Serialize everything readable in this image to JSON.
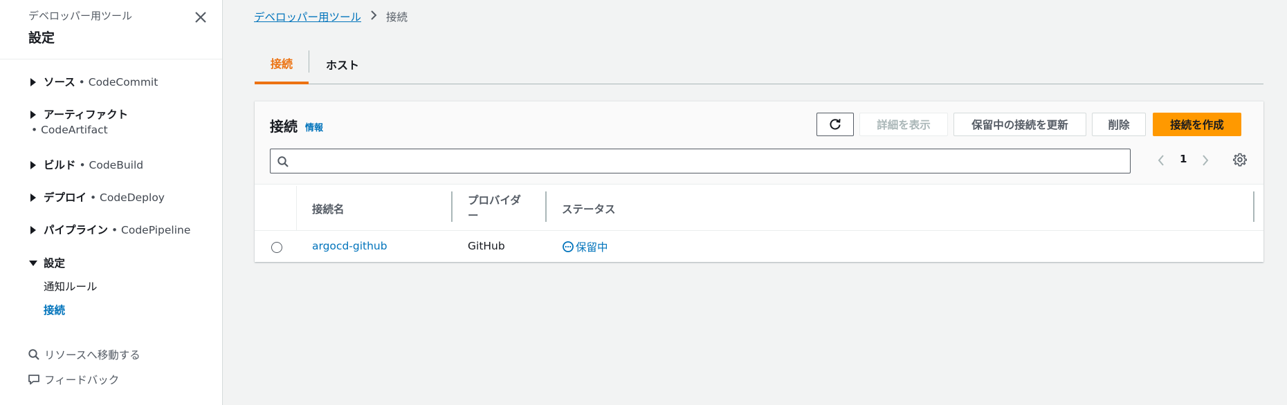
{
  "sidebar": {
    "subtitle": "デベロッパー用ツール",
    "title": "設定",
    "sections": [
      {
        "label": "ソース",
        "service": "• CodeCommit"
      },
      {
        "label": "アーティファクト",
        "service": "• CodeArtifact"
      },
      {
        "label": "ビルド",
        "service": "• CodeBuild"
      },
      {
        "label": "デプロイ",
        "service": "• CodeDeploy"
      },
      {
        "label": "パイプライン",
        "service": "• CodePipeline"
      },
      {
        "label": "設定",
        "service": ""
      }
    ],
    "settings_items": [
      "通知ルール",
      "接続"
    ],
    "utilities": {
      "goto_resource": "リソースへ移動する",
      "feedback": "フィードバック"
    }
  },
  "breadcrumb": {
    "root": "デベロッパー用ツール",
    "current": "接続"
  },
  "tabs": [
    {
      "label": "接続"
    },
    {
      "label": "ホスト"
    }
  ],
  "panel": {
    "title": "接続",
    "info": "情報",
    "buttons": {
      "view_details": "詳細を表示",
      "update_pending": "保留中の接続を更新",
      "delete": "削除",
      "create": "接続を作成"
    },
    "search": {
      "value": "",
      "placeholder": ""
    },
    "pagination": {
      "current_page": "1"
    },
    "columns": [
      "接続名",
      "プロバイダー",
      "ステータス"
    ],
    "rows": [
      {
        "name": "argocd-github",
        "provider": "GitHub",
        "status": "保留中"
      }
    ]
  },
  "colors": {
    "accent": "#ec7211",
    "primary_button": "#ff9900",
    "link": "#0073bb"
  }
}
